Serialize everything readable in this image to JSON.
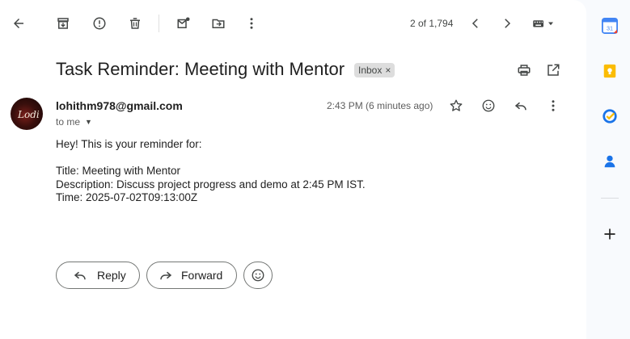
{
  "toolbar": {
    "back": "back-arrow-icon",
    "archive": "archive-icon",
    "report": "report-spam-icon",
    "delete": "delete-icon",
    "mark_unread": "mark-unread-icon",
    "move": "move-to-icon",
    "more": "more-vert-icon",
    "counter": "2 of 1,794"
  },
  "email": {
    "subject": "Task Reminder: Meeting with Mentor",
    "label": "Inbox",
    "label_remove": "×",
    "sender": "lohithm978@gmail.com",
    "avatar_mark": "Lodi",
    "to": "to me",
    "time": "2:43 PM (6 minutes ago)",
    "body": [
      "Hey! This is your reminder for:",
      "",
      "Title: Meeting with Mentor",
      "Description: Discuss project progress and demo at 2:45 PM IST.",
      "Time: 2025-07-02T09:13:00Z"
    ]
  },
  "actions": {
    "reply": "Reply",
    "forward": "Forward"
  },
  "sidebar": {
    "calendar_day": "31",
    "apps": [
      "calendar-icon",
      "keep-icon",
      "tasks-icon",
      "contacts-icon",
      "add-icon"
    ]
  },
  "colors": {
    "calendar_blue": "#4285f4",
    "keep_yellow": "#fbbc04",
    "tasks_blue": "#1a73e8",
    "contacts_blue": "#1a73e8"
  }
}
